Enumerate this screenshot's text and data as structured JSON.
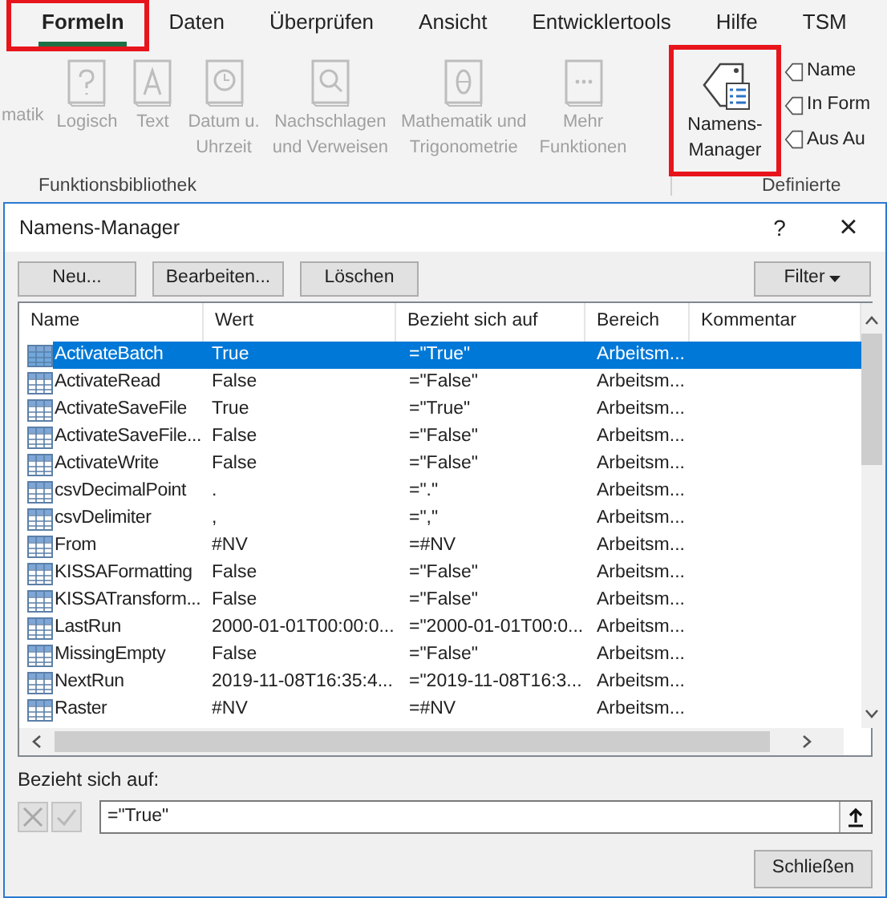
{
  "ribbon_tabs": [
    {
      "label": "Formeln",
      "selected": true,
      "highlighted": true
    },
    {
      "label": "Daten",
      "selected": false,
      "highlighted": false
    },
    {
      "label": "Überprüfen",
      "selected": false,
      "highlighted": false
    },
    {
      "label": "Ansicht",
      "selected": false,
      "highlighted": false
    },
    {
      "label": "Entwicklertools",
      "selected": false,
      "highlighted": false
    },
    {
      "label": "Hilfe",
      "selected": false,
      "highlighted": false
    },
    {
      "label": "TSM",
      "selected": false,
      "highlighted": false
    }
  ],
  "function_library": {
    "cut_label": "matik",
    "buttons": [
      {
        "kind": "question",
        "lines": [
          "Logisch"
        ],
        "disabled": true
      },
      {
        "kind": "letter",
        "lines": [
          "Text"
        ],
        "disabled": true
      },
      {
        "kind": "clock",
        "lines": [
          "Datum u.",
          "Uhrzeit"
        ],
        "disabled": true
      },
      {
        "kind": "magnifier",
        "lines": [
          "Nachschlagen",
          "und Verweisen"
        ],
        "disabled": true
      },
      {
        "kind": "theta",
        "lines": [
          "Mathematik und",
          "Trigonometrie"
        ],
        "disabled": true
      },
      {
        "kind": "dots",
        "lines": [
          "Mehr",
          "Funktionen"
        ],
        "disabled": true
      }
    ],
    "group_label": "Funktionsbibliothek"
  },
  "defined_names": {
    "manager_button": {
      "lines": [
        "Namens-",
        "Manager"
      ],
      "highlighted": true
    },
    "small_buttons": [
      "Name",
      "In Form",
      "Aus Au"
    ],
    "group_label": "Definierte"
  },
  "dialog": {
    "title": "Namens-Manager",
    "help": "?",
    "close": "×",
    "buttons": [
      "Neu...",
      "Bearbeiten...",
      "Löschen"
    ],
    "filter_button": "Filter",
    "table": {
      "columns": [
        "Name",
        "Wert",
        "Bezieht sich auf",
        "Bereich",
        "Kommentar"
      ],
      "rows": [
        {
          "name": "ActivateBatch",
          "value": "True",
          "refers_to": "=\"True\"",
          "scope": "Arbeitsm...",
          "selected": true
        },
        {
          "name": "ActivateRead",
          "value": "False",
          "refers_to": "=\"False\"",
          "scope": "Arbeitsm...",
          "selected": false
        },
        {
          "name": "ActivateSaveFile",
          "value": "True",
          "refers_to": "=\"True\"",
          "scope": "Arbeitsm...",
          "selected": false
        },
        {
          "name": "ActivateSaveFile...",
          "value": "False",
          "refers_to": "=\"False\"",
          "scope": "Arbeitsm...",
          "selected": false
        },
        {
          "name": "ActivateWrite",
          "value": "False",
          "refers_to": "=\"False\"",
          "scope": "Arbeitsm...",
          "selected": false
        },
        {
          "name": "csvDecimalPoint",
          "value": ".",
          "refers_to": "=\".\"",
          "scope": "Arbeitsm...",
          "selected": false
        },
        {
          "name": "csvDelimiter",
          "value": ",",
          "refers_to": "=\",\"",
          "scope": "Arbeitsm...",
          "selected": false
        },
        {
          "name": "From",
          "value": "#NV",
          "refers_to": "=#NV",
          "scope": "Arbeitsm...",
          "selected": false
        },
        {
          "name": "KISSAFormatting",
          "value": "False",
          "refers_to": "=\"False\"",
          "scope": "Arbeitsm...",
          "selected": false
        },
        {
          "name": "KISSATransform...",
          "value": "False",
          "refers_to": "=\"False\"",
          "scope": "Arbeitsm...",
          "selected": false
        },
        {
          "name": "LastRun",
          "value": "2000-01-01T00:00:0...",
          "refers_to": "=\"2000-01-01T00:0...",
          "scope": "Arbeitsm...",
          "selected": false
        },
        {
          "name": "MissingEmpty",
          "value": "False",
          "refers_to": "=\"False\"",
          "scope": "Arbeitsm...",
          "selected": false
        },
        {
          "name": "NextRun",
          "value": "2019-11-08T16:35:4...",
          "refers_to": "=\"2019-11-08T16:3...",
          "scope": "Arbeitsm...",
          "selected": false
        },
        {
          "name": "Raster",
          "value": "#NV",
          "refers_to": "=#NV",
          "scope": "Arbeitsm...",
          "selected": false
        }
      ]
    },
    "refers_label": "Bezieht sich auf:",
    "refers_value": "=\"True\"",
    "close_button": "Schließen"
  }
}
